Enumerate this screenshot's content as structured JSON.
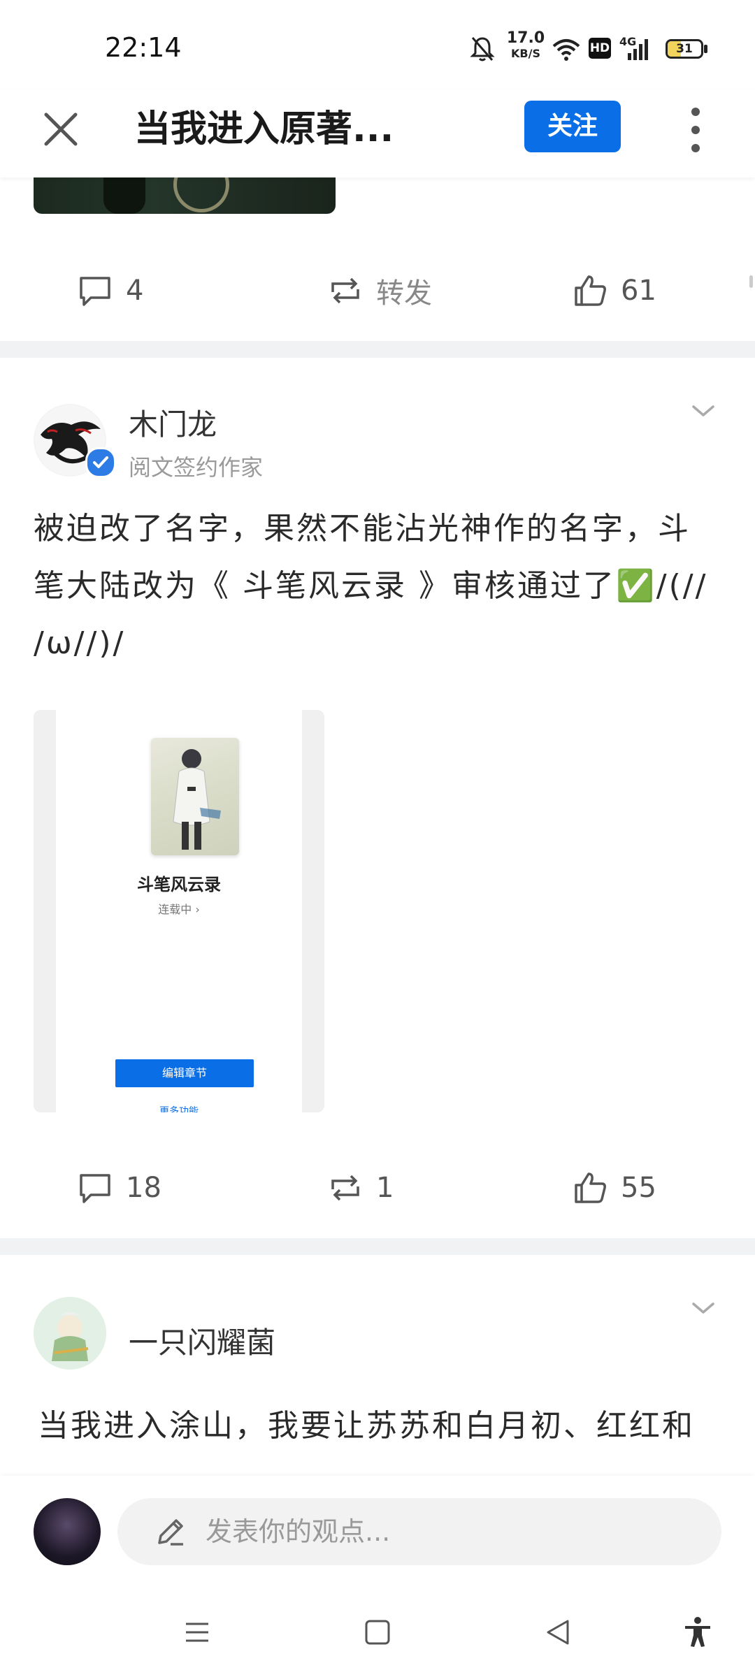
{
  "status_bar": {
    "time": "22:14",
    "net_speed_value": "17.0",
    "net_speed_unit": "KB/S",
    "signal_label": "4G",
    "battery": "31",
    "hd_label": "HD"
  },
  "header": {
    "title": "当我进入原著...",
    "follow_label": "关注"
  },
  "post1_actions": {
    "comments": "4",
    "repost": "转发",
    "likes": "61"
  },
  "post2": {
    "author": "木门龙",
    "author_subtitle": "阅文签约作家",
    "text_lines": [
      "被迫改了名字，果然不能沾光神作的名字，斗",
      "笔大陆改为《 斗笔风云录 》审核通过了✅/(//",
      "/ω//)/"
    ],
    "card": {
      "book_title": "斗笔风云录",
      "book_status": "连载中 ›",
      "edit_label": "编辑章节",
      "more_label": "更多功能"
    },
    "actions": {
      "comments": "18",
      "reposts": "1",
      "likes": "55"
    }
  },
  "post3": {
    "author": "一只闪耀菌",
    "text_lines": [
      "当我进入涂山，我要让苏苏和白月初、红红和"
    ]
  },
  "comment_bar": {
    "placeholder": "发表你的观点..."
  },
  "colors": {
    "accent": "#0a6fe6",
    "divider": "#f1f2f4"
  }
}
